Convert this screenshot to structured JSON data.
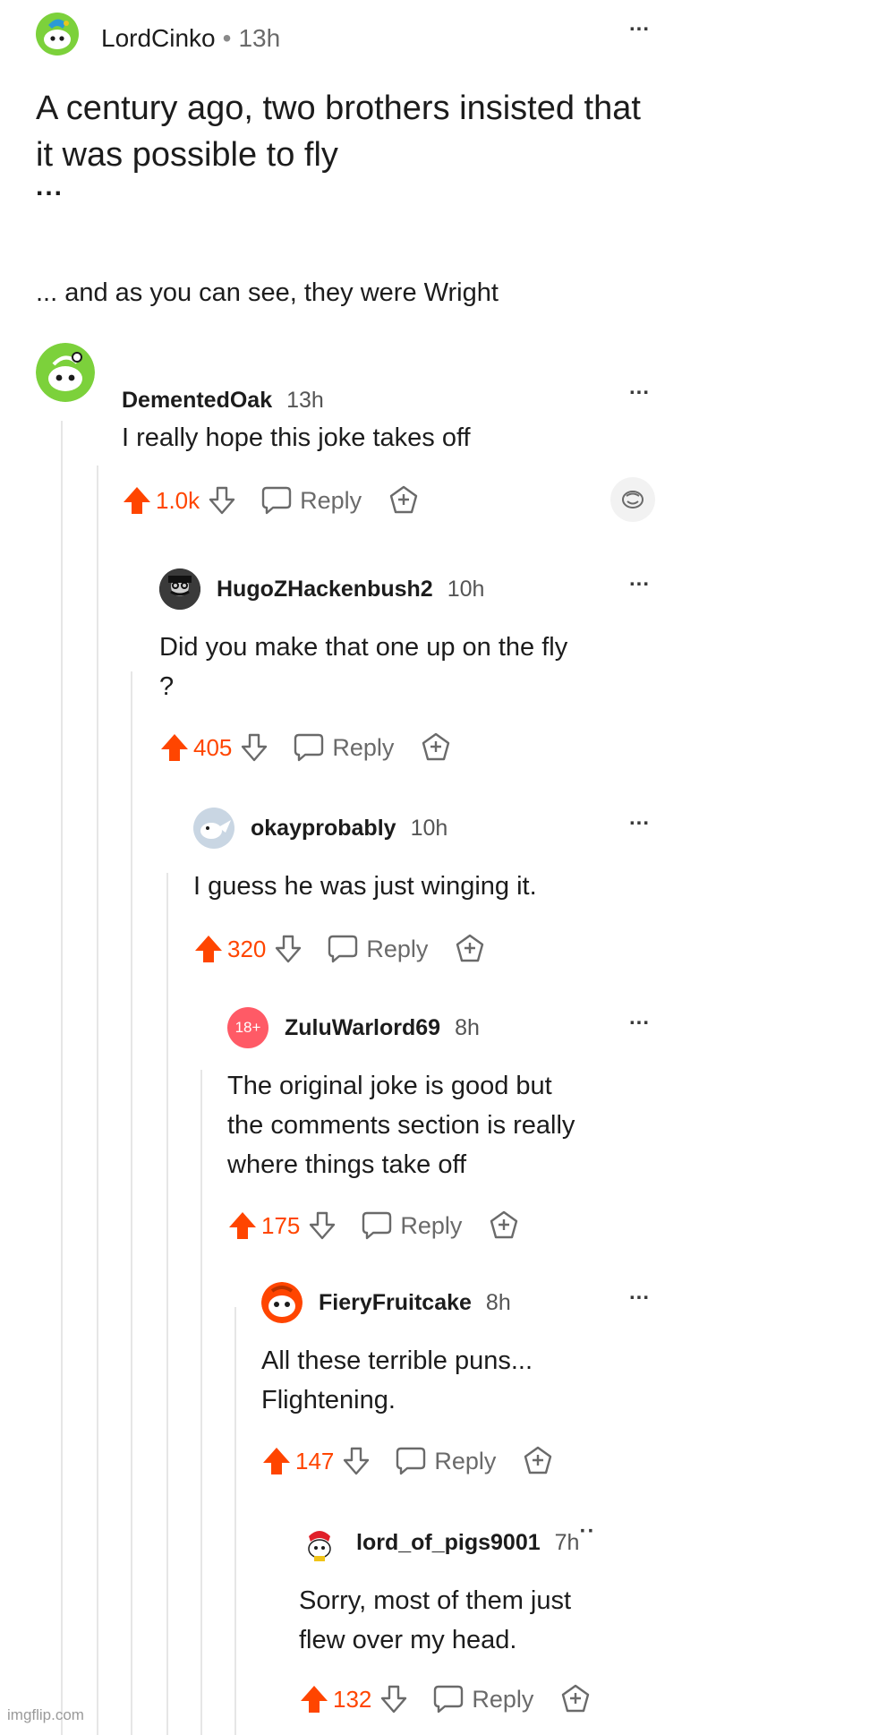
{
  "post": {
    "username": "LordCinko",
    "time": "13h",
    "title": "A century ago, two brothers insisted that it was possible to fly",
    "title_ellipsis": "...",
    "body": "... and as you can see, they were Wright",
    "more_label": "..."
  },
  "comments": [
    {
      "username": "DementedOak",
      "time": "13h",
      "text": "I really hope this joke takes off",
      "score": "1.0k",
      "reply_label": "Reply",
      "more_label": "..."
    },
    {
      "username": "HugoZHackenbush2",
      "time": "10h",
      "text": "Did you make that one up on the fly\n?",
      "score": "405",
      "reply_label": "Reply",
      "more_label": "..."
    },
    {
      "username": "okayprobably",
      "time": "10h",
      "text": "I guess he was just winging it.",
      "score": "320",
      "reply_label": "Reply",
      "more_label": "..."
    },
    {
      "username": "ZuluWarlord69",
      "time": "8h",
      "avatar_badge": "18+",
      "text": "The original joke is good but\nthe comments section is really\nwhere things take off",
      "score": "175",
      "reply_label": "Reply",
      "more_label": "..."
    },
    {
      "username": "FieryFruitcake",
      "time": "8h",
      "text": "All these terrible puns...\nFlightening.",
      "score": "147",
      "reply_label": "Reply",
      "more_label": "..."
    },
    {
      "username": "lord_of_pigs9001",
      "time": "7h",
      "text": "Sorry, most of them just\nflew over my head.",
      "score": "132",
      "reply_label": "Reply",
      "more_label": "··"
    }
  ],
  "watermark": "imgflip.com",
  "colors": {
    "upvote": "#ff4500",
    "text": "#1c1c1c",
    "muted": "#6a6a6a",
    "thread_line": "#e6e6e6"
  },
  "icons": [
    "upvote-arrow-icon",
    "downvote-arrow-icon",
    "speech-bubble-icon",
    "award-icon",
    "snoo-avatar-icon"
  ]
}
